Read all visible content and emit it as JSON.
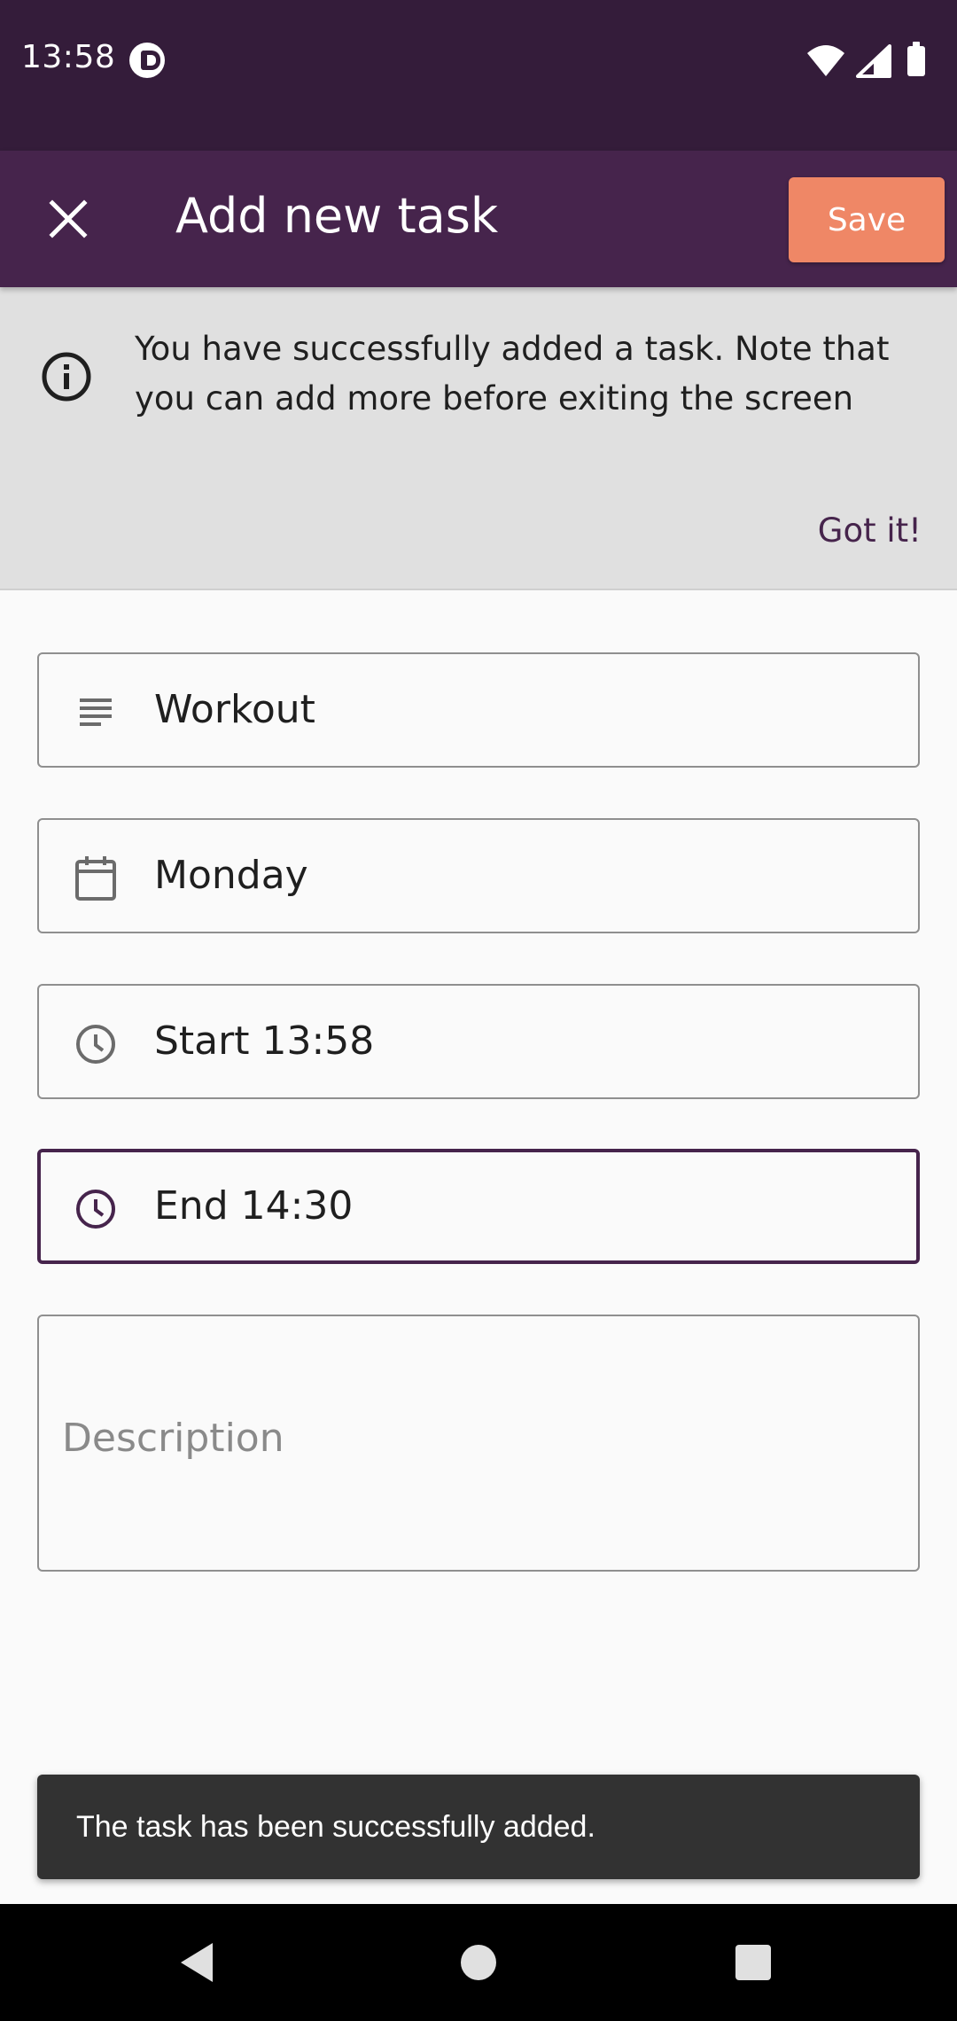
{
  "status_bar": {
    "time": "13:58",
    "icons": [
      "app-notification-icon",
      "wifi-icon",
      "signal-icon",
      "battery-icon"
    ]
  },
  "app_bar": {
    "title": "Add new task",
    "close_icon": "close-icon",
    "save_label": "Save"
  },
  "banner": {
    "icon": "info-icon",
    "message": "You have successfully added a task. Note that you can add more before exiting the screen",
    "action_label": "Got it!"
  },
  "form": {
    "title_field": {
      "icon": "notes-icon",
      "value": "Workout"
    },
    "day_field": {
      "icon": "calendar-icon",
      "value": "Monday"
    },
    "start_field": {
      "icon": "clock-icon",
      "value": "Start 13:58"
    },
    "end_field": {
      "icon": "clock-icon",
      "value": "End 14:30",
      "focused": true
    },
    "description_field": {
      "placeholder": "Description",
      "value": ""
    }
  },
  "snackbar": {
    "message": "The task has been successfully added."
  },
  "nav_bar": {
    "icons": [
      "back-icon",
      "home-icon",
      "recents-icon"
    ]
  },
  "colors": {
    "status_bar": "#341c3a",
    "app_bar": "#46244c",
    "save_button": "#ef8766",
    "banner_bg": "#e0e0e0",
    "focused_border": "#46244c",
    "snackbar_bg": "#323232"
  }
}
